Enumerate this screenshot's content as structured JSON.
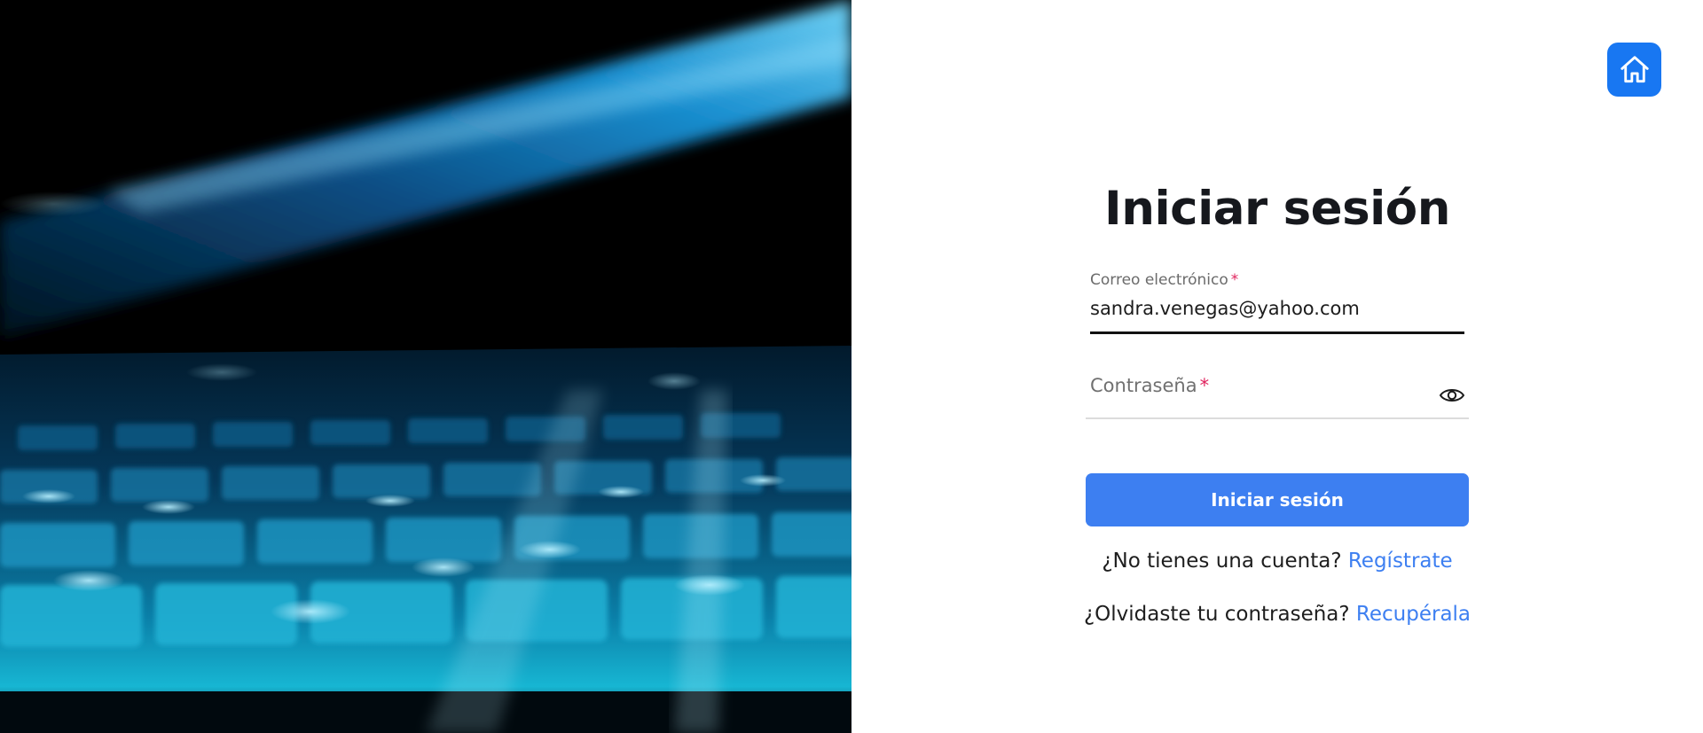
{
  "header": {
    "home_icon": "home-icon"
  },
  "login": {
    "title": "Iniciar sesión",
    "email_label": "Correo electrónico",
    "email_value": "sandra.venegas@yahoo.com",
    "password_label": "Contraseña",
    "required_marker": "*",
    "password_toggle_icon": "eye-icon",
    "submit_label": "Iniciar sesión",
    "register_prompt": "¿No tienes una cuenta?",
    "register_link": "Regístrate",
    "forgot_prompt": "¿Olvidaste tu contraseña?",
    "forgot_link": "Recupérala"
  },
  "colors": {
    "primary": "#3d7ff1",
    "home_button": "#1877f2",
    "required": "#e0245e",
    "title": "#16181d"
  }
}
